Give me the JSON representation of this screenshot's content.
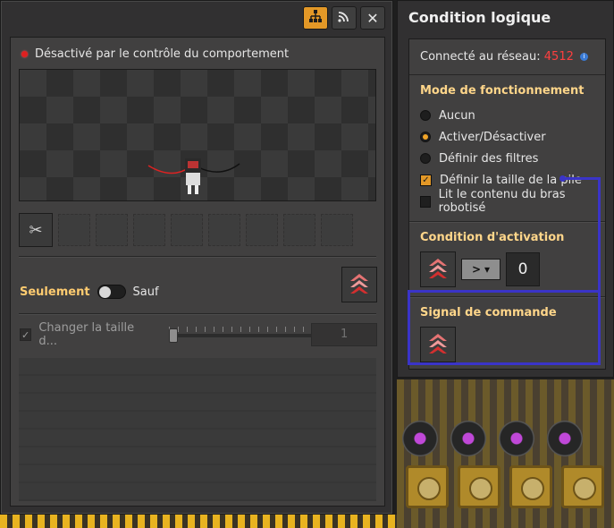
{
  "left_panel": {
    "status_text": "Désactivé par le contrôle du comportement",
    "tool_icon": "disconnect-wire-icon",
    "filter_mode": {
      "whitelist_label": "Seulement",
      "blacklist_label": "Sauf"
    },
    "stack_size": {
      "label": "Changer la taille d...",
      "value": "1"
    },
    "titlebar_icons": [
      "network-icon",
      "radio-icon",
      "close-icon"
    ]
  },
  "right_panel": {
    "title": "Condition logique",
    "network": {
      "label": "Connecté au réseau:",
      "id": "4512"
    },
    "mode": {
      "title": "Mode de fonctionnement",
      "options": [
        {
          "label": "Aucun",
          "selected": false
        },
        {
          "label": "Activer/Désactiver",
          "selected": true
        },
        {
          "label": "Définir des filtres",
          "selected": false
        }
      ],
      "checkboxes": [
        {
          "label": "Définir la taille de la pile",
          "checked": true
        },
        {
          "label": "Lit le contenu du bras robotisé",
          "checked": false
        }
      ]
    },
    "enable_condition": {
      "title": "Condition d'activation",
      "comparator": ">",
      "value": "0"
    },
    "command_signal": {
      "title": "Signal de commande"
    }
  },
  "colors": {
    "accent": "#e39827",
    "header_text": "#ffd68a",
    "network_id": "#ff3f3f",
    "highlight": "#3a34c8"
  }
}
